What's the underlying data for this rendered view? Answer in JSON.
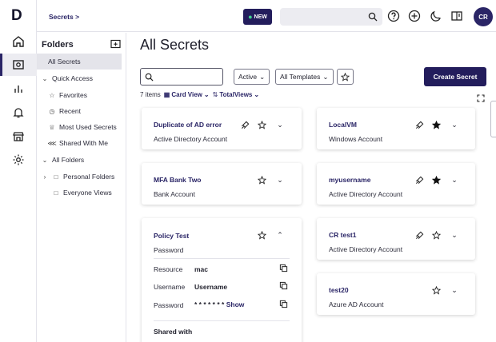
{
  "rail": {
    "logo": "D",
    "items": [
      {
        "icon": "home-icon"
      },
      {
        "icon": "vault-icon",
        "active": true
      },
      {
        "icon": "reports-icon"
      },
      {
        "icon": "bell-icon"
      },
      {
        "icon": "store-icon"
      },
      {
        "icon": "gear-icon"
      }
    ]
  },
  "topbar": {
    "breadcrumb": "Secrets >",
    "new_badge": "NEW",
    "avatar_initials": "CR"
  },
  "folders": {
    "title": "Folders",
    "items": [
      {
        "label": "All Secrets",
        "icon": "",
        "active": true
      },
      {
        "label": "Quick Access",
        "icon": "chevron-down-icon"
      },
      {
        "label": "Favorites",
        "icon": "star-icon"
      },
      {
        "label": "Recent",
        "icon": "clock-icon"
      },
      {
        "label": "Most Used Secrets",
        "icon": "trophy-icon"
      },
      {
        "label": "Shared With Me",
        "icon": "share-icon"
      },
      {
        "label": "All Folders",
        "icon": "chevron-down-icon"
      },
      {
        "label": "Personal Folders",
        "icon": "folder-icon"
      },
      {
        "label": "Everyone Views",
        "icon": "folder-icon"
      }
    ]
  },
  "main": {
    "title": "All Secrets",
    "search_placeholder": "",
    "status_filter": "Active",
    "template_filter": "All Templates",
    "create_label": "Create Secret",
    "item_count": "7 items",
    "view_mode": "Card View",
    "total_views": "TotalViews"
  },
  "cards": [
    {
      "name": "Duplicate of AD error",
      "type": "Active Directory Account",
      "favorite": false,
      "launcher": true
    },
    {
      "name": "LocalVM",
      "type": "Windows Account",
      "favorite": true,
      "launcher": true
    },
    {
      "name": "MFA Bank Two",
      "type": "Bank Account",
      "favorite": false,
      "launcher": false
    },
    {
      "name": "myusername",
      "type": "Active Directory Account",
      "favorite": true,
      "launcher": true
    },
    {
      "name": "Policy Test",
      "type": "Password",
      "favorite": false,
      "launcher": false,
      "expanded": true
    },
    {
      "name": "CR test1",
      "type": "Active Directory Account",
      "favorite": false,
      "launcher": true
    },
    {
      "name": "test20",
      "type": "Azure AD Account",
      "favorite": false,
      "launcher": false
    }
  ],
  "policy_details": {
    "resource_label": "Resource",
    "resource_value": "mac",
    "username_label": "Username",
    "username_value": "Username",
    "password_label": "Password",
    "password_mask": "* * * * * * *",
    "show_label": "Show",
    "shared_with_label": "Shared with"
  },
  "colors": {
    "brand": "#231d5c",
    "accent": "#2a2566",
    "new_dot": "#3fd28f"
  }
}
